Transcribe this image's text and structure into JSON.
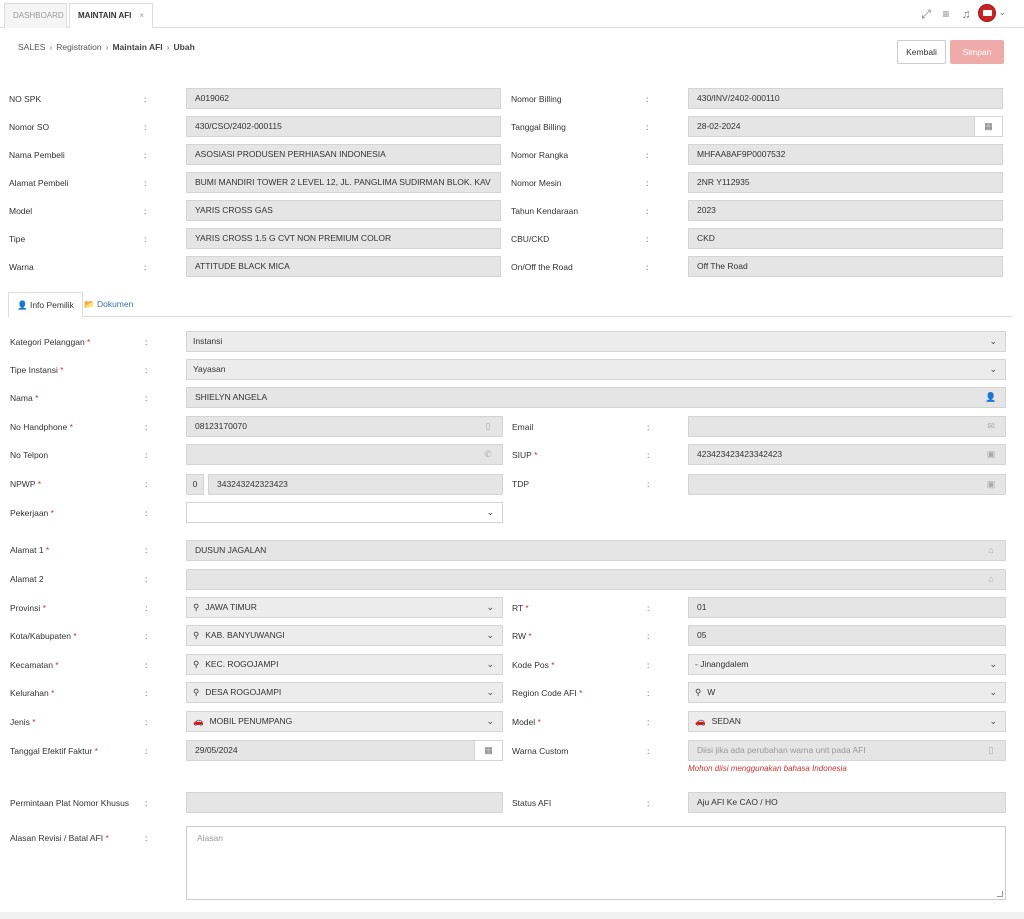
{
  "tabs": [
    {
      "label": "DASHBOARD"
    },
    {
      "label": "MAINTAIN AFI",
      "close": "×"
    }
  ],
  "breadcrumb": [
    "SALES",
    "Registration",
    "Maintain AFI",
    "Ubah"
  ],
  "buttons": {
    "kembali": "Kembali",
    "simpan": "Simpan"
  },
  "colon": ":",
  "header_left": [
    {
      "label": "NO SPK",
      "value": "A019062"
    },
    {
      "label": "Nomor SO",
      "value": "430/CSO/2402-000115"
    },
    {
      "label": "Nama Pembeli",
      "value": "ASOSIASI PRODUSEN PERHIASAN INDONESIA"
    },
    {
      "label": "Alamat Pembeli",
      "value": "BUMI MANDIRI TOWER 2 LEVEL 12, JL. PANGLIMA SUDIRMAN BLOK. KAV"
    },
    {
      "label": "Model",
      "value": "YARIS CROSS GAS"
    },
    {
      "label": "Tipe",
      "value": "YARIS CROSS 1.5 G CVT NON PREMIUM COLOR"
    },
    {
      "label": "Warna",
      "value": "ATTITUDE BLACK MICA"
    }
  ],
  "header_right": [
    {
      "label": "Nomor Billing",
      "value": "430/INV/2402-000110"
    },
    {
      "label": "Tanggal Billing",
      "value": "28-02-2024"
    },
    {
      "label": "Nomor Rangka",
      "value": "MHFAA8AF9P0007532"
    },
    {
      "label": "Nomor Mesin",
      "value": "2NR Y112935"
    },
    {
      "label": "Tahun Kendaraan",
      "value": "2023"
    },
    {
      "label": "CBU/CKD",
      "value": "CKD"
    },
    {
      "label": "On/Off the Road",
      "value": "Off The Road"
    }
  ],
  "section_tabs": {
    "info": "Info Pemilik",
    "dokumen": "Dokumen"
  },
  "form": {
    "kategori": {
      "label": "Kategori Pelanggan",
      "value": "Instansi"
    },
    "tipe_instansi": {
      "label": "Tipe Instansi",
      "value": "Yayasan"
    },
    "nama": {
      "label": "Nama",
      "value": "SHIELYN ANGELA"
    },
    "no_hp": {
      "label": "No Handphone",
      "value": "08123170070"
    },
    "email": {
      "label": "Email",
      "value": ""
    },
    "no_telpon": {
      "label": "No Telpon",
      "value": ""
    },
    "siup": {
      "label": "SIUP",
      "value": "423423423423342423"
    },
    "npwp": {
      "label": "NPWP",
      "prefix": "0",
      "value": "343243242323423"
    },
    "tdp": {
      "label": "TDP",
      "value": ""
    },
    "pekerjaan": {
      "label": "Pekerjaan",
      "value": ""
    },
    "alamat1": {
      "label": "Alamat 1",
      "value": "DUSUN JAGALAN"
    },
    "alamat2": {
      "label": "Alamat 2",
      "value": ""
    },
    "provinsi": {
      "label": "Provinsi",
      "value": "JAWA TIMUR"
    },
    "rt": {
      "label": "RT",
      "value": "01"
    },
    "kota": {
      "label": "Kota/Kabupaten",
      "value": "KAB. BANYUWANGI"
    },
    "rw": {
      "label": "RW",
      "value": "05"
    },
    "kecamatan": {
      "label": "Kecamatan",
      "value": "KEC. ROGOJAMPI"
    },
    "kode_pos": {
      "label": "Kode Pos",
      "value": "- Jinangdalem"
    },
    "kelurahan": {
      "label": "Kelurahan",
      "value": "DESA ROGOJAMPI"
    },
    "region": {
      "label": "Region Code AFI",
      "value": "W"
    },
    "jenis": {
      "label": "Jenis",
      "value": "MOBIL PENUMPANG"
    },
    "model": {
      "label": "Model",
      "value": "SEDAN"
    },
    "tgl_efektif": {
      "label": "Tanggal Efektif Faktur",
      "value": "29/05/2024"
    },
    "warna_custom": {
      "label": "Warna Custom",
      "placeholder": "Diisi jika ada perubahan warna unit pada AFI",
      "error": "Mohon diisi menggunakan bahasa Indonesia"
    },
    "plat": {
      "label": "Permintaan Plat Nomor Khusus",
      "value": ""
    },
    "status_afi": {
      "label": "Status AFI",
      "value": "Aju AFI Ke CAO / HO"
    },
    "alasan": {
      "label": "Alasan Revisi / Batal AFI",
      "placeholder": "Alasan"
    }
  },
  "required_mark": "*"
}
